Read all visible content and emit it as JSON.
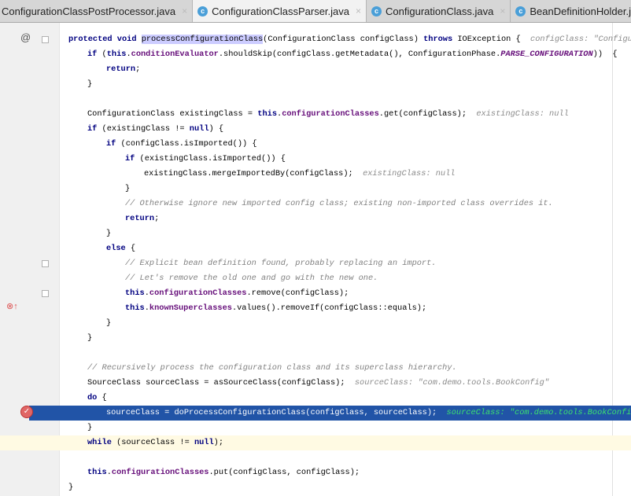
{
  "tabs": [
    {
      "label": "ConfigurationClassPostProcessor.java",
      "active": false,
      "icon": "none"
    },
    {
      "label": "ConfigurationClassParser.java",
      "active": true,
      "icon": "class-icon"
    },
    {
      "label": "ConfigurationClass.java",
      "active": false,
      "icon": "class-icon"
    },
    {
      "label": "BeanDefinitionHolder.j",
      "active": false,
      "icon": "class-icon"
    }
  ],
  "close_glyph": "×",
  "gutter": {
    "override_marker": "@",
    "breakpoint_icon": "breakpoint-check-icon",
    "overridden_icon": "overridden-method-icon"
  },
  "lines": [
    {
      "i": 0,
      "t": [
        [
          "kw",
          "protected void "
        ],
        [
          "sel",
          "processConfigurationClass"
        ],
        [
          "",
          "(ConfigurationClass configClass) "
        ],
        [
          "kw",
          "throws "
        ],
        [
          "",
          "IOException {  "
        ],
        [
          "hint",
          "configClass: \"Configu"
        ]
      ]
    },
    {
      "i": 1,
      "t": [
        [
          "kw",
          "if "
        ],
        [
          "",
          "("
        ],
        [
          "kw",
          "this"
        ],
        [
          "",
          "."
        ],
        [
          "fld",
          "conditionEvaluator"
        ],
        [
          "",
          ".shouldSkip(configClass.getMetadata(), ConfigurationPhase."
        ],
        [
          "cst",
          "PARSE_CONFIGURATION"
        ],
        [
          "",
          "))  {"
        ]
      ]
    },
    {
      "i": 2,
      "t": [
        [
          "kw",
          "return"
        ],
        [
          "",
          ";"
        ]
      ]
    },
    {
      "i": 1,
      "t": [
        [
          "",
          "}"
        ]
      ]
    },
    {
      "i": 0,
      "t": []
    },
    {
      "i": 1,
      "t": [
        [
          "",
          "ConfigurationClass existingClass = "
        ],
        [
          "kw",
          "this"
        ],
        [
          "",
          "."
        ],
        [
          "fld",
          "configurationClasses"
        ],
        [
          "",
          ".get(configClass);  "
        ],
        [
          "hint",
          "existingClass: null"
        ]
      ]
    },
    {
      "i": 1,
      "t": [
        [
          "kw",
          "if "
        ],
        [
          "",
          "(existingClass != "
        ],
        [
          "kw",
          "null"
        ],
        [
          "",
          ") {"
        ]
      ]
    },
    {
      "i": 2,
      "t": [
        [
          "kw",
          "if "
        ],
        [
          "",
          "(configClass.isImported()) {"
        ]
      ]
    },
    {
      "i": 3,
      "t": [
        [
          "kw",
          "if "
        ],
        [
          "",
          "(existingClass.isImported()) {"
        ]
      ]
    },
    {
      "i": 4,
      "t": [
        [
          "",
          "existingClass.mergeImportedBy(configClass);  "
        ],
        [
          "hint",
          "existingClass: null"
        ]
      ]
    },
    {
      "i": 3,
      "t": [
        [
          "",
          "}"
        ]
      ]
    },
    {
      "i": 3,
      "t": [
        [
          "cm",
          "// Otherwise ignore new imported config class; existing non-imported class overrides it."
        ]
      ]
    },
    {
      "i": 3,
      "t": [
        [
          "kw",
          "return"
        ],
        [
          "",
          ";"
        ]
      ]
    },
    {
      "i": 2,
      "t": [
        [
          "",
          "}"
        ]
      ]
    },
    {
      "i": 2,
      "t": [
        [
          "kw",
          "else "
        ],
        [
          "",
          "{"
        ]
      ]
    },
    {
      "i": 3,
      "t": [
        [
          "cm",
          "// Explicit bean definition found, probably replacing an import."
        ]
      ]
    },
    {
      "i": 3,
      "t": [
        [
          "cm",
          "// Let's remove the old one and go with the new one."
        ]
      ]
    },
    {
      "i": 3,
      "t": [
        [
          "kw",
          "this"
        ],
        [
          "",
          "."
        ],
        [
          "fld",
          "configurationClasses"
        ],
        [
          "",
          ".remove(configClass);"
        ]
      ]
    },
    {
      "i": 3,
      "t": [
        [
          "kw",
          "this"
        ],
        [
          "",
          "."
        ],
        [
          "fld",
          "knownSuperclasses"
        ],
        [
          "",
          ".values().removeIf(configClass::equals);"
        ]
      ]
    },
    {
      "i": 2,
      "t": [
        [
          "",
          "}"
        ]
      ]
    },
    {
      "i": 1,
      "t": [
        [
          "",
          "}"
        ]
      ]
    },
    {
      "i": 0,
      "t": []
    },
    {
      "i": 1,
      "t": [
        [
          "cm",
          "// Recursively process the configuration class and its superclass hierarchy."
        ]
      ]
    },
    {
      "i": 1,
      "t": [
        [
          "",
          "SourceClass sourceClass = asSourceClass(configClass);  "
        ],
        [
          "hint",
          "sourceClass: \"com.demo.tools.BookConfig\""
        ]
      ]
    },
    {
      "i": 1,
      "t": [
        [
          "kw",
          "do "
        ],
        [
          "",
          "{"
        ]
      ]
    },
    {
      "i": 2,
      "t": [
        [
          "",
          "sourceClass = doProcessConfigurationClass(configClass, sourceClass);  "
        ],
        [
          "hint",
          "sourceClass: \"com.demo.tools.BookConfig\""
        ]
      ],
      "exec": true
    },
    {
      "i": 1,
      "t": [
        [
          "",
          "}"
        ]
      ]
    },
    {
      "i": 1,
      "t": [
        [
          "kw",
          "while "
        ],
        [
          "",
          "(sourceClass != "
        ],
        [
          "kw",
          "null"
        ],
        [
          "",
          ");"
        ]
      ],
      "cur": true
    },
    {
      "i": 0,
      "t": []
    },
    {
      "i": 1,
      "t": [
        [
          "kw",
          "this"
        ],
        [
          "",
          "."
        ],
        [
          "fld",
          "configurationClasses"
        ],
        [
          "",
          ".put(configClass, configClass);"
        ]
      ]
    },
    {
      "i": 0,
      "t": [
        [
          "",
          "}"
        ]
      ]
    }
  ]
}
